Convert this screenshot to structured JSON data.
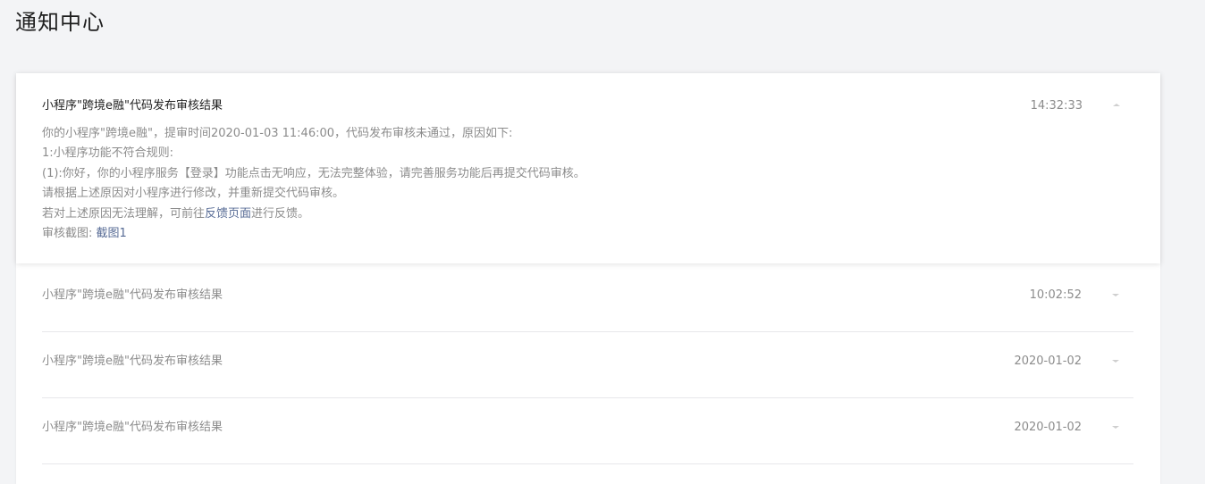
{
  "page": {
    "title": "通知中心"
  },
  "notifications": [
    {
      "title": "小程序\"跨境e融\"代码发布审核结果",
      "time": "14:32:33",
      "expanded": true,
      "body": {
        "line1": "你的小程序\"跨境e融\"，提审时间2020-01-03 11:46:00，代码发布审核未通过，原因如下:",
        "line2": "1:小程序功能不符合规则:",
        "line3": "(1):你好，你的小程序服务【登录】功能点击无响应，无法完整体验，请完善服务功能后再提交代码审核。",
        "line4": "请根据上述原因对小程序进行修改，并重新提交代码审核。",
        "line5_prefix": "若对上述原因无法理解，可前往",
        "line5_link": "反馈页面",
        "line5_suffix": "进行反馈。",
        "line6_prefix": "审核截图: ",
        "line6_link": "截图1"
      }
    },
    {
      "title": "小程序\"跨境e融\"代码发布审核结果",
      "time": "10:02:52",
      "expanded": false
    },
    {
      "title": "小程序\"跨境e融\"代码发布审核结果",
      "time": "2020-01-02",
      "expanded": false
    },
    {
      "title": "小程序\"跨境e融\"代码发布审核结果",
      "time": "2020-01-02",
      "expanded": false
    }
  ],
  "icons": {
    "collapse": "chevron-up-icon",
    "expand": "chevron-down-icon"
  },
  "colors": {
    "link": "#576b95",
    "muted_text": "#8c8c8c",
    "background": "#f3f4f6"
  }
}
